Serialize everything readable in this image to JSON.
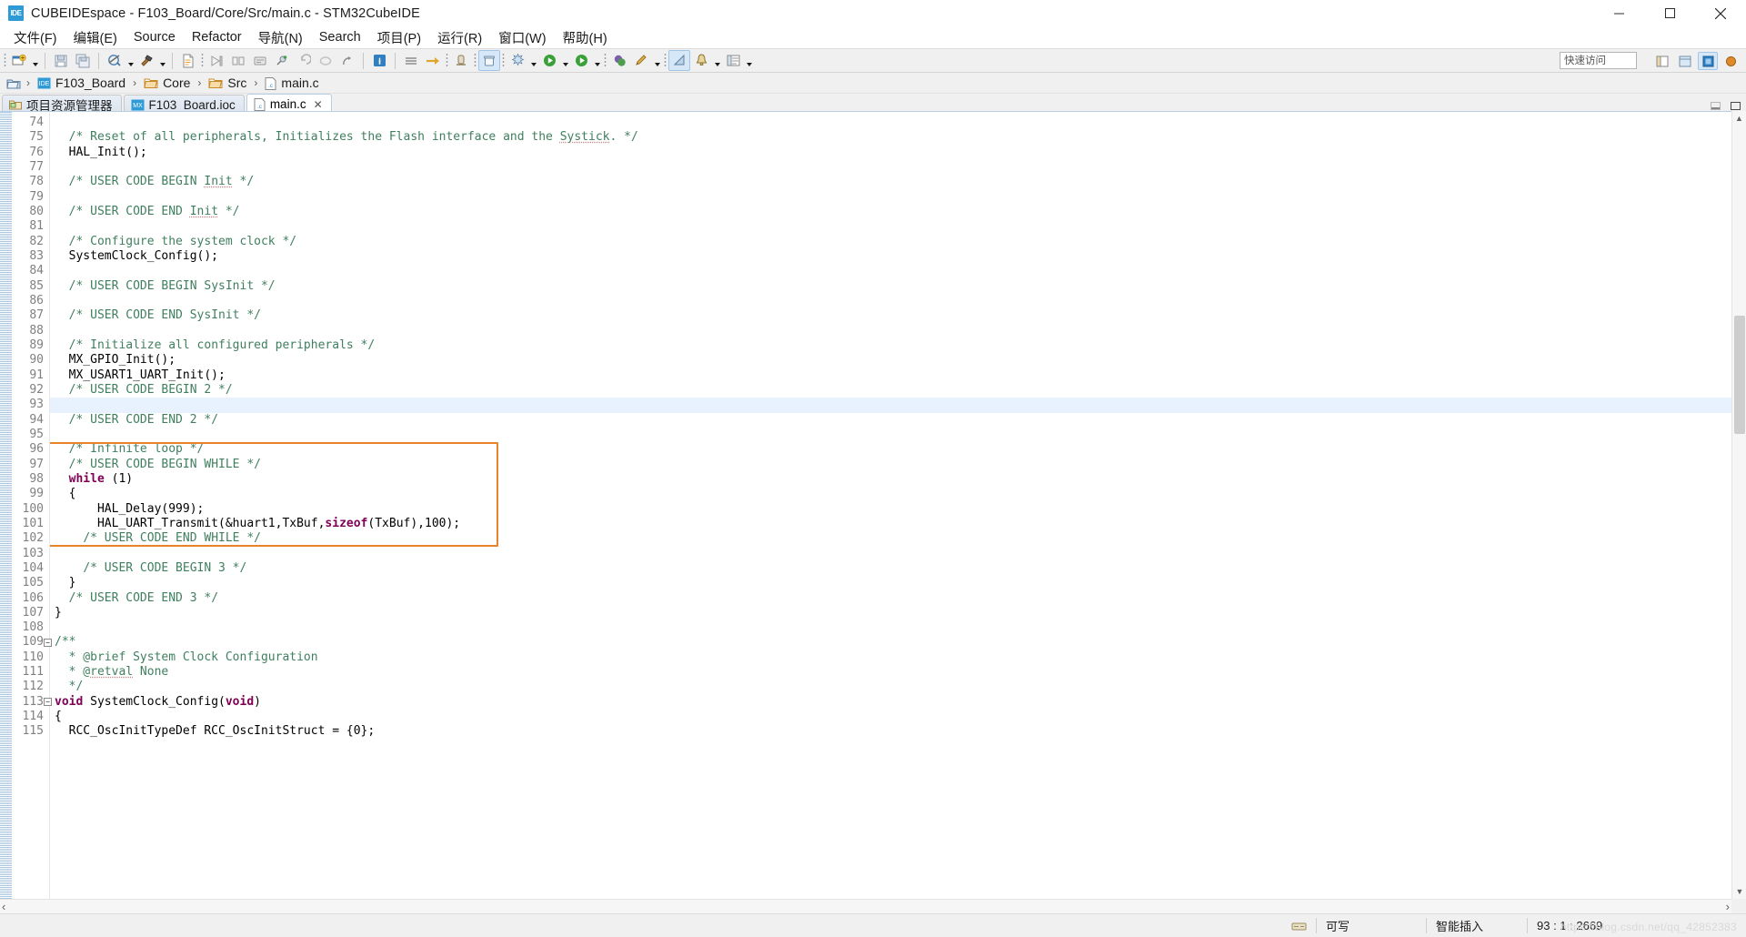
{
  "window": {
    "app_icon_label": "IDE",
    "title": "CUBEIDEspace - F103_Board/Core/Src/main.c - STM32CubeIDE",
    "minimize_label": "Minimize",
    "maximize_label": "Maximize",
    "close_label": "Close"
  },
  "menu": {
    "items": [
      {
        "label": "文件(F)"
      },
      {
        "label": "编辑(E)"
      },
      {
        "label": "Source"
      },
      {
        "label": "Refactor"
      },
      {
        "label": "导航(N)"
      },
      {
        "label": "Search"
      },
      {
        "label": "项目(P)"
      },
      {
        "label": "运行(R)"
      },
      {
        "label": "窗口(W)"
      },
      {
        "label": "帮助(H)"
      }
    ]
  },
  "toolbar": {
    "quick_access_placeholder": "快速访问",
    "buttons": [
      {
        "name": "new-icon"
      },
      {
        "name": "save-icon"
      },
      {
        "name": "save-all-icon"
      },
      {
        "name": "build-all-icon"
      },
      {
        "name": "build-hammer-icon"
      },
      {
        "name": "new-c-file-icon"
      },
      {
        "name": "debug-step-icon"
      },
      {
        "name": "columns-icon"
      },
      {
        "name": "console-icon"
      },
      {
        "name": "pin-icon"
      },
      {
        "name": "undo-icon"
      },
      {
        "name": "redo-icon"
      },
      {
        "name": "export-icon"
      },
      {
        "name": "info-icon"
      },
      {
        "name": "menu-lines-icon"
      },
      {
        "name": "next-annotation-icon"
      },
      {
        "name": "search-ref-icon"
      },
      {
        "name": "trash-icon"
      },
      {
        "name": "clean-icon"
      },
      {
        "name": "debug-run-icon"
      },
      {
        "name": "run-icon"
      },
      {
        "name": "profile-icon"
      },
      {
        "name": "pencil-icon"
      },
      {
        "name": "ruler-icon"
      },
      {
        "name": "bell-icon"
      },
      {
        "name": "list-icon"
      }
    ],
    "perspectives": [
      {
        "name": "open-perspective-icon"
      },
      {
        "name": "perspective-cdt-icon"
      },
      {
        "name": "perspective-device-icon"
      },
      {
        "name": "perspective-debug-icon"
      }
    ]
  },
  "breadcrumb": {
    "root_icon": "project-icon",
    "items": [
      {
        "label": "F103_Board",
        "icon": "ide-project-icon"
      },
      {
        "label": "Core",
        "icon": "folder-icon"
      },
      {
        "label": "Src",
        "icon": "folder-icon"
      },
      {
        "label": "main.c",
        "icon": "c-file-icon"
      }
    ],
    "separator": "›"
  },
  "tabs": [
    {
      "label": "项目资源管理器",
      "icon": "project-explorer-icon",
      "active": false,
      "closable": false
    },
    {
      "label": "F103_Board.ioc",
      "icon": "mx-icon",
      "active": false,
      "closable": false
    },
    {
      "label": "main.c",
      "icon": "c-file-icon",
      "active": true,
      "closable": true,
      "close_glyph": "✕"
    }
  ],
  "editor": {
    "first_line": 74,
    "current_line": 93,
    "highlight_box": {
      "color": "#e8832a",
      "from_line": 96,
      "to_line": 102
    },
    "lines": [
      {
        "n": 74,
        "fold": null,
        "tokens": [
          {
            "t": "",
            "c": ""
          }
        ]
      },
      {
        "n": 75,
        "fold": null,
        "tokens": [
          {
            "t": "  ",
            "c": ""
          },
          {
            "t": "/* Reset of all peripherals, Initializes the Flash interface and the ",
            "c": "cmt"
          },
          {
            "t": "Systick",
            "c": "cmt sp"
          },
          {
            "t": ". */",
            "c": "cmt"
          }
        ]
      },
      {
        "n": 76,
        "fold": null,
        "tokens": [
          {
            "t": "  HAL_Init();",
            "c": ""
          }
        ]
      },
      {
        "n": 77,
        "fold": null,
        "tokens": [
          {
            "t": "",
            "c": ""
          }
        ]
      },
      {
        "n": 78,
        "fold": null,
        "tokens": [
          {
            "t": "  ",
            "c": ""
          },
          {
            "t": "/* USER CODE BEGIN ",
            "c": "cmt"
          },
          {
            "t": "Init",
            "c": "cmt sp"
          },
          {
            "t": " */",
            "c": "cmt"
          }
        ]
      },
      {
        "n": 79,
        "fold": null,
        "tokens": [
          {
            "t": "",
            "c": ""
          }
        ]
      },
      {
        "n": 80,
        "fold": null,
        "tokens": [
          {
            "t": "  ",
            "c": ""
          },
          {
            "t": "/* USER CODE END ",
            "c": "cmt"
          },
          {
            "t": "Init",
            "c": "cmt sp"
          },
          {
            "t": " */",
            "c": "cmt"
          }
        ]
      },
      {
        "n": 81,
        "fold": null,
        "tokens": [
          {
            "t": "",
            "c": ""
          }
        ]
      },
      {
        "n": 82,
        "fold": null,
        "tokens": [
          {
            "t": "  ",
            "c": ""
          },
          {
            "t": "/* Configure the system clock */",
            "c": "cmt"
          }
        ]
      },
      {
        "n": 83,
        "fold": null,
        "tokens": [
          {
            "t": "  SystemClock_Config();",
            "c": ""
          }
        ]
      },
      {
        "n": 84,
        "fold": null,
        "tokens": [
          {
            "t": "",
            "c": ""
          }
        ]
      },
      {
        "n": 85,
        "fold": null,
        "tokens": [
          {
            "t": "  ",
            "c": ""
          },
          {
            "t": "/* USER CODE BEGIN SysInit */",
            "c": "cmt"
          }
        ]
      },
      {
        "n": 86,
        "fold": null,
        "tokens": [
          {
            "t": "",
            "c": ""
          }
        ]
      },
      {
        "n": 87,
        "fold": null,
        "tokens": [
          {
            "t": "  ",
            "c": ""
          },
          {
            "t": "/* USER CODE END SysInit */",
            "c": "cmt"
          }
        ]
      },
      {
        "n": 88,
        "fold": null,
        "tokens": [
          {
            "t": "",
            "c": ""
          }
        ]
      },
      {
        "n": 89,
        "fold": null,
        "tokens": [
          {
            "t": "  ",
            "c": ""
          },
          {
            "t": "/* Initialize all configured peripherals */",
            "c": "cmt"
          }
        ]
      },
      {
        "n": 90,
        "fold": null,
        "tokens": [
          {
            "t": "  MX_GPIO_Init();",
            "c": ""
          }
        ]
      },
      {
        "n": 91,
        "fold": null,
        "tokens": [
          {
            "t": "  MX_USART1_UART_Init();",
            "c": ""
          }
        ]
      },
      {
        "n": 92,
        "fold": null,
        "tokens": [
          {
            "t": "  ",
            "c": ""
          },
          {
            "t": "/* USER CODE BEGIN 2 */",
            "c": "cmt"
          }
        ]
      },
      {
        "n": 93,
        "fold": null,
        "current": true,
        "tokens": [
          {
            "t": "",
            "c": ""
          }
        ]
      },
      {
        "n": 94,
        "fold": null,
        "tokens": [
          {
            "t": "  ",
            "c": ""
          },
          {
            "t": "/* USER CODE END 2 */",
            "c": "cmt"
          }
        ]
      },
      {
        "n": 95,
        "fold": null,
        "tokens": [
          {
            "t": "",
            "c": ""
          }
        ]
      },
      {
        "n": 96,
        "fold": null,
        "tokens": [
          {
            "t": "  ",
            "c": ""
          },
          {
            "t": "/* Infinite loop */",
            "c": "cmt"
          }
        ]
      },
      {
        "n": 97,
        "fold": null,
        "tokens": [
          {
            "t": "  ",
            "c": ""
          },
          {
            "t": "/* USER CODE BEGIN WHILE */",
            "c": "cmt"
          }
        ]
      },
      {
        "n": 98,
        "fold": null,
        "tokens": [
          {
            "t": "  ",
            "c": ""
          },
          {
            "t": "while",
            "c": "kw"
          },
          {
            "t": " (1)",
            "c": ""
          }
        ]
      },
      {
        "n": 99,
        "fold": null,
        "tokens": [
          {
            "t": "  {",
            "c": ""
          }
        ]
      },
      {
        "n": 100,
        "fold": null,
        "tokens": [
          {
            "t": "      HAL_Delay(999);",
            "c": ""
          }
        ]
      },
      {
        "n": 101,
        "fold": null,
        "tokens": [
          {
            "t": "      HAL_UART_Transmit(&huart1,TxBuf,",
            "c": ""
          },
          {
            "t": "sizeof",
            "c": "kw"
          },
          {
            "t": "(TxBuf),100);",
            "c": ""
          }
        ]
      },
      {
        "n": 102,
        "fold": null,
        "tokens": [
          {
            "t": "    ",
            "c": ""
          },
          {
            "t": "/* USER CODE END WHILE */",
            "c": "cmt"
          }
        ]
      },
      {
        "n": 103,
        "fold": null,
        "tokens": [
          {
            "t": "",
            "c": ""
          }
        ]
      },
      {
        "n": 104,
        "fold": null,
        "tokens": [
          {
            "t": "    ",
            "c": ""
          },
          {
            "t": "/* USER CODE BEGIN 3 */",
            "c": "cmt"
          }
        ]
      },
      {
        "n": 105,
        "fold": null,
        "tokens": [
          {
            "t": "  }",
            "c": ""
          }
        ]
      },
      {
        "n": 106,
        "fold": null,
        "tokens": [
          {
            "t": "  ",
            "c": ""
          },
          {
            "t": "/* USER CODE END 3 */",
            "c": "cmt"
          }
        ]
      },
      {
        "n": 107,
        "fold": null,
        "tokens": [
          {
            "t": "}",
            "c": ""
          }
        ]
      },
      {
        "n": 108,
        "fold": null,
        "tokens": [
          {
            "t": "",
            "c": ""
          }
        ]
      },
      {
        "n": 109,
        "fold": "minus",
        "tokens": [
          {
            "t": "/**",
            "c": "cmt"
          }
        ]
      },
      {
        "n": 110,
        "fold": null,
        "tokens": [
          {
            "t": "  * @brief System Clock Configuration",
            "c": "cmt"
          }
        ]
      },
      {
        "n": 111,
        "fold": null,
        "tokens": [
          {
            "t": "  * @",
            "c": "cmt"
          },
          {
            "t": "retval",
            "c": "cmt sp"
          },
          {
            "t": " None",
            "c": "cmt"
          }
        ]
      },
      {
        "n": 112,
        "fold": null,
        "tokens": [
          {
            "t": "  */",
            "c": "cmt"
          }
        ]
      },
      {
        "n": 113,
        "fold": "minus",
        "tokens": [
          {
            "t": "void",
            "c": "kw"
          },
          {
            "t": " SystemClock_Config(",
            "c": ""
          },
          {
            "t": "void",
            "c": "kw"
          },
          {
            "t": ")",
            "c": ""
          }
        ]
      },
      {
        "n": 114,
        "fold": null,
        "tokens": [
          {
            "t": "{",
            "c": ""
          }
        ]
      },
      {
        "n": 115,
        "fold": null,
        "tokens": [
          {
            "t": "  RCC_OscInitTypeDef RCC_OscInitStruct = {0};",
            "c": ""
          }
        ]
      }
    ]
  },
  "scrollbar": {
    "up_glyph": "▲",
    "down_glyph": "▼",
    "left_glyph": "‹",
    "right_glyph": "›"
  },
  "statusbar": {
    "writable": "可写",
    "insert_mode": "智能插入",
    "position": "93 : 1 : 2669",
    "lock_icon": "writable-icon",
    "watermark": "https://blog.csdn.net/qq_42852383"
  }
}
